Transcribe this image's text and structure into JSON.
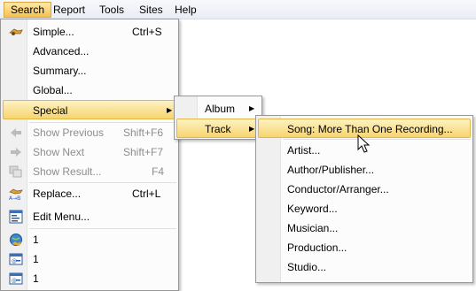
{
  "menubar": {
    "items": [
      {
        "label": "Search"
      },
      {
        "label": "Report"
      },
      {
        "label": "Tools"
      },
      {
        "label": "Sites"
      },
      {
        "label": "Help"
      }
    ]
  },
  "search_menu": {
    "items": [
      {
        "label": "Simple...",
        "shortcut": "Ctrl+S",
        "icon": "binoculars-icon",
        "enabled": true
      },
      {
        "label": "Advanced...",
        "shortcut": "",
        "enabled": true
      },
      {
        "label": "Summary...",
        "shortcut": "",
        "enabled": true
      },
      {
        "label": "Global...",
        "shortcut": "",
        "enabled": true
      },
      {
        "label": "Special",
        "submenu": true,
        "highlighted": true
      },
      {
        "label": "Show Previous",
        "shortcut": "Shift+F6",
        "icon": "left-arrow-icon",
        "enabled": false
      },
      {
        "label": "Show Next",
        "shortcut": "Shift+F7",
        "icon": "right-arrow-icon",
        "enabled": false
      },
      {
        "label": "Show Result...",
        "shortcut": "F4",
        "icon": "windows-icon",
        "enabled": false
      },
      {
        "label": "Replace...",
        "shortcut": "Ctrl+L",
        "icon": "replace-ab-icon",
        "enabled": true
      },
      {
        "label": "Edit Menu...",
        "shortcut": "",
        "icon": "edit-menu-icon",
        "enabled": true
      },
      {
        "label": "1",
        "icon": "globe-search-icon"
      },
      {
        "label": "1",
        "icon": "window-search-icon"
      },
      {
        "label": "1",
        "icon": "window-search-icon"
      }
    ]
  },
  "special_menu": {
    "items": [
      {
        "label": "Album",
        "submenu": true
      },
      {
        "label": "Track",
        "submenu": true,
        "highlighted": true
      }
    ]
  },
  "track_menu": {
    "items": [
      {
        "label": "Song: More Than One Recording...",
        "highlighted": true
      },
      {
        "label": "Artist..."
      },
      {
        "label": "Author/Publisher..."
      },
      {
        "label": "Conductor/Arranger..."
      },
      {
        "label": "Keyword..."
      },
      {
        "label": "Musician..."
      },
      {
        "label": "Production..."
      },
      {
        "label": "Studio..."
      }
    ]
  },
  "colors": {
    "highlight_top": "#fdf2c4",
    "highlight_bottom": "#f7d56f",
    "highlight_border": "#e1b64a",
    "disabled_text": "#8d8d8d"
  }
}
